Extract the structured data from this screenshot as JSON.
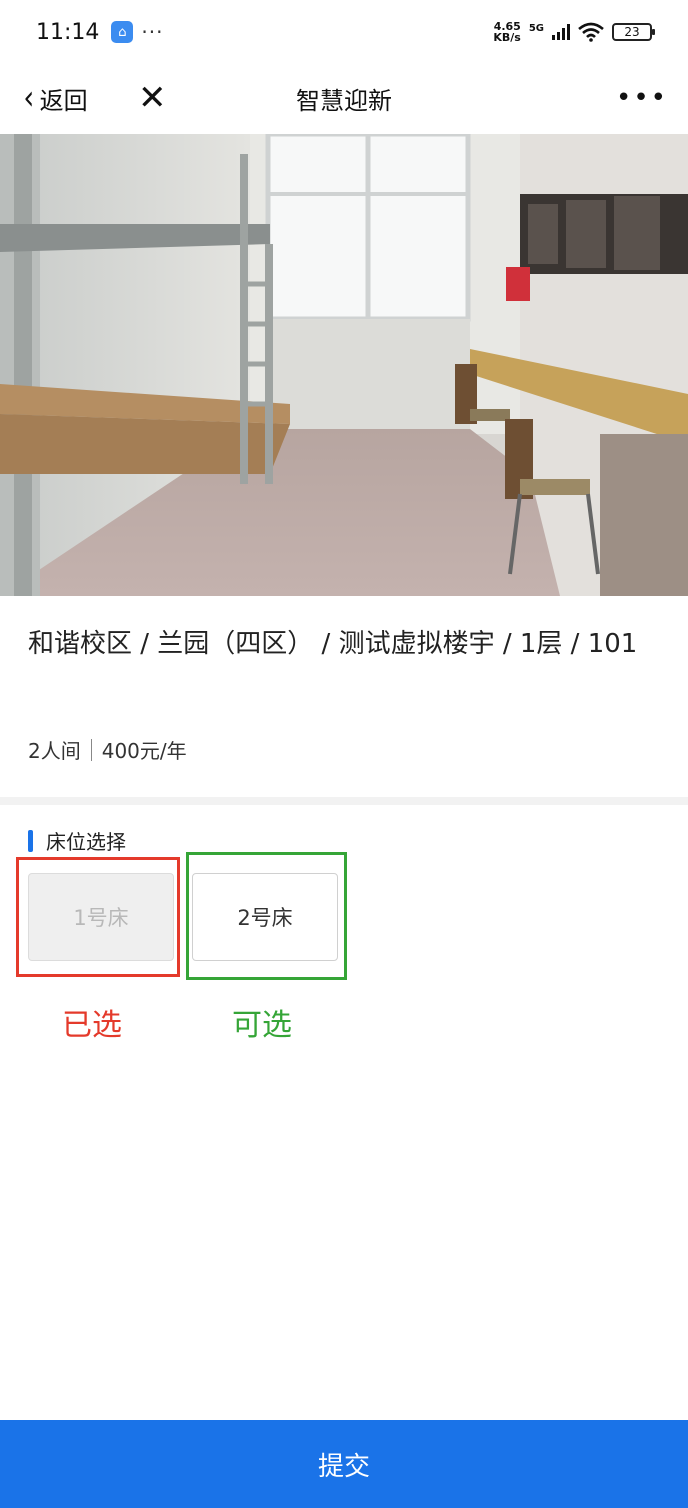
{
  "status_bar": {
    "time": "11:14",
    "net_speed_value": "4.65",
    "net_speed_unit": "KB/s",
    "network_type": "5G",
    "battery": "23",
    "more": "···"
  },
  "nav": {
    "back_label": "返回",
    "close_glyph": "✕",
    "title": "智慧迎新",
    "more_glyph": "•••"
  },
  "room": {
    "path": "和谐校区 / 兰园（四区） / 测试虚拟楼宇 / 1层 / 101",
    "capacity": "2人间",
    "price": "400元/年"
  },
  "bed_section": {
    "title": "床位选择",
    "beds": [
      {
        "label": "1号床",
        "state": "selected"
      },
      {
        "label": "2号床",
        "state": "available"
      }
    ]
  },
  "annotations": {
    "selected": "已选",
    "available": "可选"
  },
  "submit_label": "提交",
  "colors": {
    "accent": "#1a73e8",
    "selected_frame": "#e43a2b",
    "available_frame": "#35a537"
  }
}
